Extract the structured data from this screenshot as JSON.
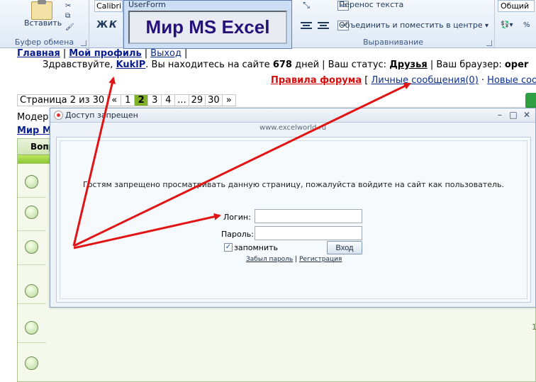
{
  "ribbon": {
    "paste_label": "Вставить",
    "clipboard_caption": "Буфер обмена",
    "font_name": "Calibri",
    "bold_label": "Ж",
    "italic_label": "К",
    "wrap_text": "Перенос текста",
    "merge_center": "Объединить и поместить в центре",
    "alignment_caption": "Выравнивание",
    "number_format": "Общий"
  },
  "userform": {
    "title": "UserForm",
    "banner": "Мир MS Excel"
  },
  "forum": {
    "nav": {
      "home": "Главная",
      "profile": "Мой профиль",
      "logout": "Выход"
    },
    "greeting": {
      "prefix": "Здравствуйте, ",
      "username": "KuklP",
      "site_text": ". Вы находитесь на сайте ",
      "days": "678",
      "days_suffix": " дней | Ваш статус: ",
      "status": "Друзья",
      "browser_text": " | Ваш браузер: ",
      "browser": "oper"
    },
    "rules": {
      "rules_link": "Правила форума",
      "bracket_open": " [ ",
      "messages_link": "Личные сообщения(0)",
      "dot_sep": " · ",
      "new_link": "Новые соо"
    },
    "pager": {
      "label": "Страница 2 из 30",
      "items": [
        "«",
        "1",
        "2",
        "3",
        "4",
        "...",
        "29",
        "30",
        "»"
      ],
      "active_index": 2
    },
    "moder_label": "Модер",
    "mir_link": "Мир М",
    "table_header": "Вопр",
    "edge_numbers": [
      "1",
      "1"
    ]
  },
  "dialog": {
    "title": "Доступ запрещен",
    "url": "www.excelworld.ru",
    "guest_message": "Гостям запрещено просматривать данную страницу, пожалуйста войдите на сайт как пользователь.",
    "login_label": "Логин:",
    "password_label": "Пароль:",
    "login_value": "",
    "password_value": "",
    "remember_checked": "✓",
    "remember_label": "запомнить",
    "enter_button": "Вход",
    "forgot_link": "Забыл пароль",
    "separator": " | ",
    "register_link": "Регистрация",
    "window_minimize": "–",
    "window_maximize": "□",
    "window_close": "✕"
  },
  "colors": {
    "annotation_red": "#e01414",
    "forum_green": "#7fb227",
    "link_blue": "#0a1f8f"
  }
}
